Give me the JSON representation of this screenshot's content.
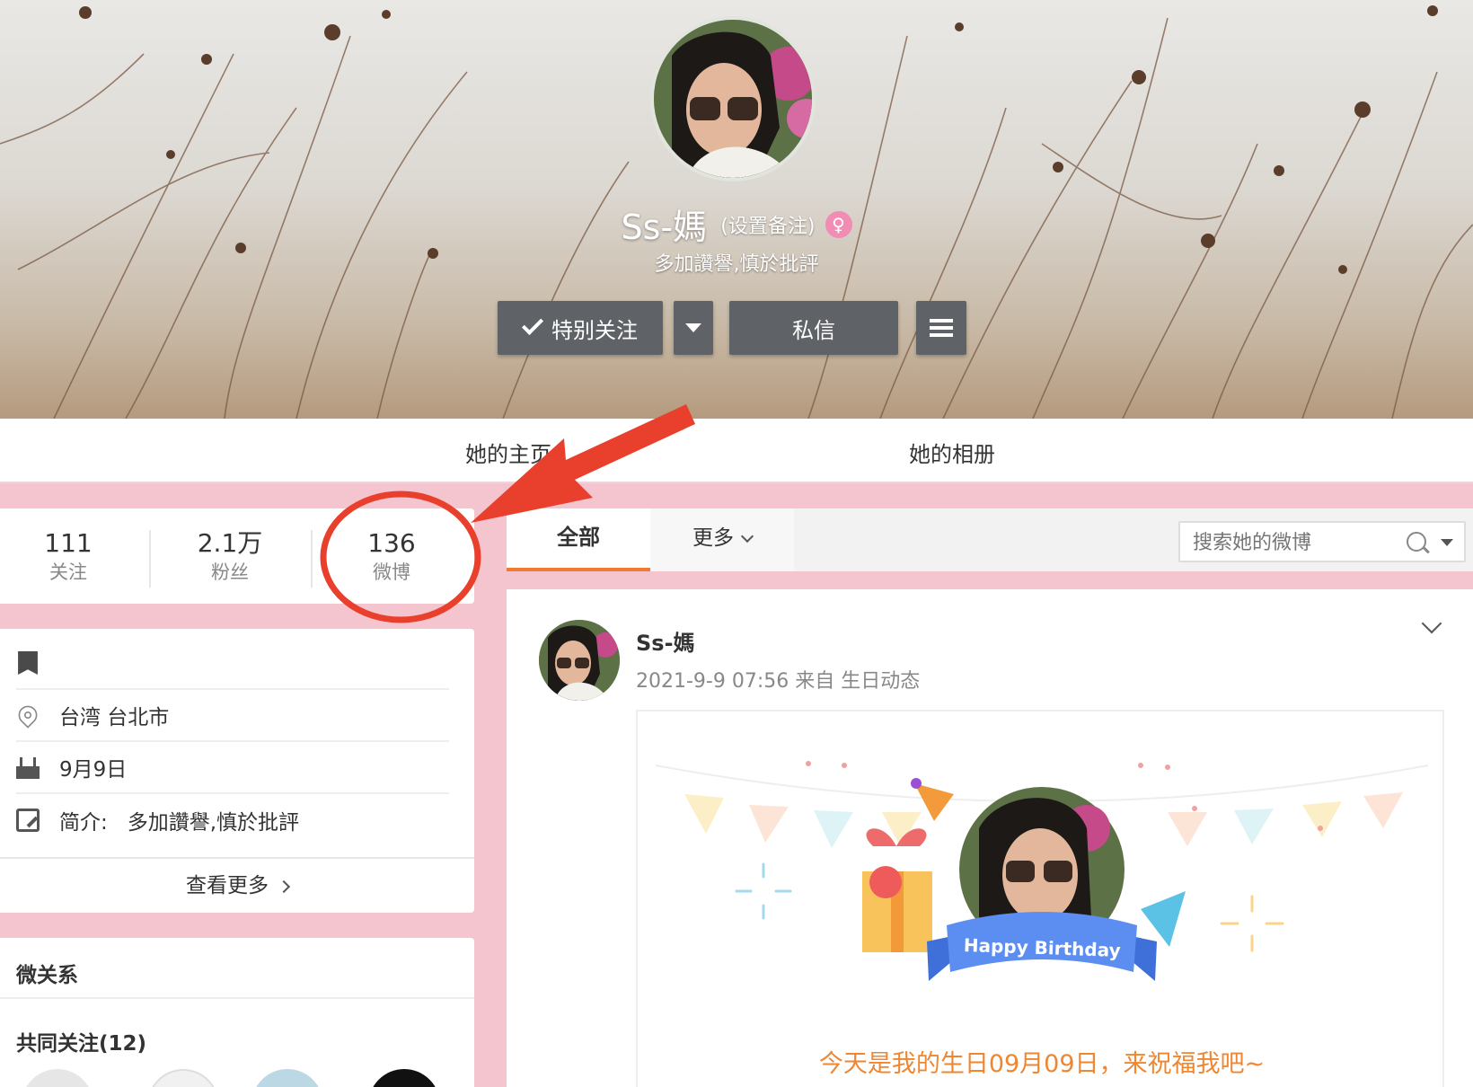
{
  "profile": {
    "name": "Ss-媽",
    "remark": "(设置备注)",
    "bio": "多加讚譽,慎於批評"
  },
  "actions": {
    "follow_label": "特别关注",
    "message_label": "私信"
  },
  "nav": {
    "home": "她的主页",
    "album": "她的相册"
  },
  "stats": [
    {
      "value": "111",
      "label": "关注"
    },
    {
      "value": "2.1万",
      "label": "粉丝"
    },
    {
      "value": "136",
      "label": "微博"
    }
  ],
  "info": {
    "location": "台湾 台北市",
    "birthday": "9月9日",
    "intro_label": "简介:",
    "intro": "多加讚譽,慎於批評",
    "see_more": "查看更多"
  },
  "relations": {
    "title": "微关系",
    "common": "共同关注(12)"
  },
  "tabs": {
    "all": "全部",
    "more": "更多"
  },
  "search": {
    "placeholder": "搜索她的微博"
  },
  "post": {
    "author": "Ss-媽",
    "time": "2021-9-9 07:56",
    "source": "来自 生日动态",
    "card_banner": "Happy Birthday",
    "caption": "今天是我的生日09月09日，来祝福我吧~"
  },
  "colors": {
    "page_bg": "#f4c5cf",
    "accent_orange": "#f07a34",
    "button_gray": "#5f6267",
    "annotation_red": "#e8402c"
  }
}
